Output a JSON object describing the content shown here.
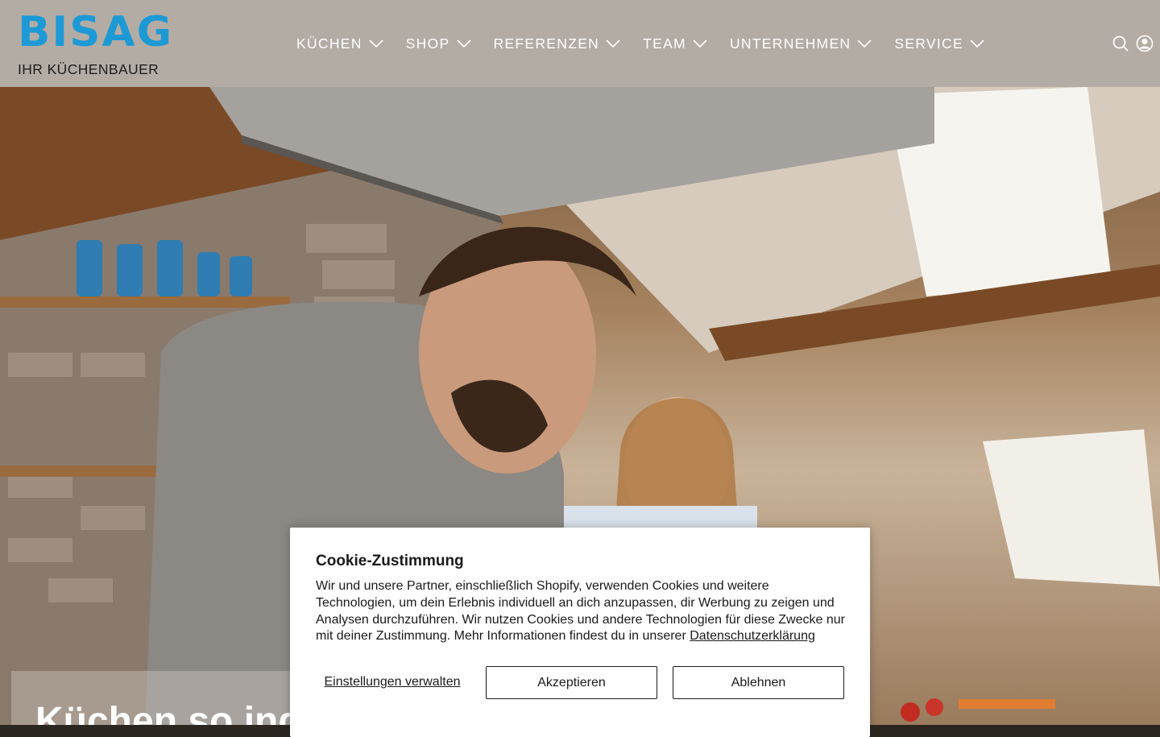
{
  "brand": {
    "logo_text": "BISAG",
    "tagline": "IHR KÜCHENBAUER",
    "accent_color": "#1d9ad6",
    "header_bg": "#b3aca4"
  },
  "nav": {
    "items": [
      {
        "label": "KÜCHEN",
        "icon": "chevron-down-icon"
      },
      {
        "label": "SHOP",
        "icon": "chevron-down-icon"
      },
      {
        "label": "REFERENZEN",
        "icon": "chevron-down-icon"
      },
      {
        "label": "TEAM",
        "icon": "chevron-down-icon"
      },
      {
        "label": "UNTERNEHMEN",
        "icon": "chevron-down-icon"
      },
      {
        "label": "SERVICE",
        "icon": "chevron-down-icon"
      }
    ]
  },
  "header_icons": {
    "search": "search-icon",
    "account": "user-account-icon"
  },
  "hero": {
    "image": "photo of a bearded man and a smiling woman cooking in a rustic attic kitchen with brick wall, wooden beams and range hood",
    "title": "Küchen so ind"
  },
  "cookie": {
    "title": "Cookie-Zustimmung",
    "body": "Wir und unsere Partner, einschließlich Shopify, verwenden Cookies und weitere Technologien, um dein Erlebnis individuell an dich anzupassen, dir Werbung zu zeigen und Analysen durchzuführen. Wir nutzen Cookies und andere Technologien für diese Zwecke nur mit deiner Zustimmung. Mehr Informationen findest du in unserer",
    "privacy_link": "Datenschutzerklärung",
    "manage_label": "Einstellungen verwalten",
    "accept_label": "Akzeptieren",
    "decline_label": "Ablehnen"
  }
}
